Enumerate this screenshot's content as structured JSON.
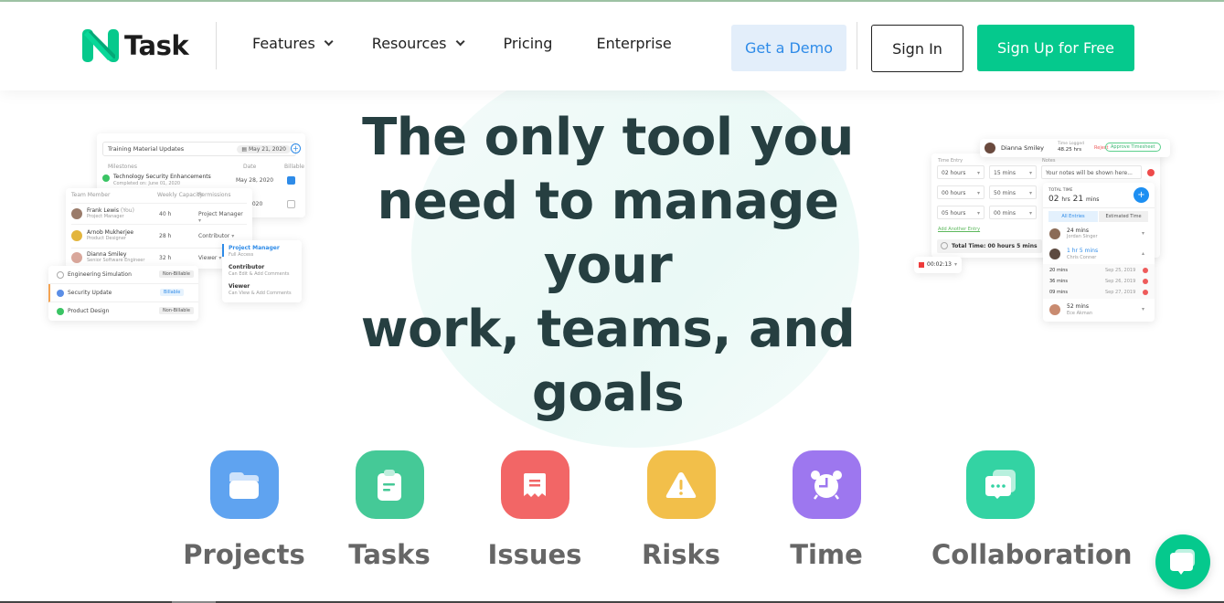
{
  "brand": {
    "name": "Task",
    "accent": "#05c98d"
  },
  "nav": {
    "items": [
      {
        "label": "Features",
        "has_dropdown": true
      },
      {
        "label": "Resources",
        "has_dropdown": true
      },
      {
        "label": "Pricing",
        "has_dropdown": false
      },
      {
        "label": "Enterprise",
        "has_dropdown": false
      }
    ],
    "demo_label": "Get a Demo",
    "signin_label": "Sign In",
    "signup_label": "Sign Up for Free"
  },
  "hero": {
    "headline_lines": [
      "The only tool you",
      "need to manage your",
      "work, teams, and",
      "goals"
    ]
  },
  "left_mock": {
    "milestone_input": "Training Material Updates",
    "milestone_date": "May 21, 2020",
    "milestone_headers": {
      "name": "Milestones",
      "date": "Date",
      "billable": "Billable"
    },
    "milestones": [
      {
        "name": "Technology Security Enhancements",
        "sub": "Completed on: June 01, 2020",
        "date": "May 28, 2020",
        "billable": true
      },
      {
        "name": "",
        "sub": "",
        "date": "2020",
        "billable": false
      }
    ],
    "team_headers": {
      "member": "Team Member",
      "capacity": "Weekly Capacity",
      "permissions": "Permissions"
    },
    "team": [
      {
        "name": "Frank Lewis",
        "you": "(You)",
        "role": "Project Manager",
        "capacity": "40 h",
        "permission": "Project Manager"
      },
      {
        "name": "Arnob Mukherjee",
        "you": "",
        "role": "Product Designer",
        "capacity": "28 h",
        "permission": "Contributor"
      },
      {
        "name": "Dianna Smiley",
        "you": "",
        "role": "Senior Software Engineer",
        "capacity": "32 h",
        "permission": "Viewer"
      }
    ],
    "permission_menu": [
      {
        "title": "Project Manager",
        "desc": "Full Access",
        "selected": true
      },
      {
        "title": "Contributor",
        "desc": "Can Edit & Add Comments",
        "selected": false
      },
      {
        "title": "Viewer",
        "desc": "Can View & Add Comments",
        "selected": false
      }
    ],
    "tasks": [
      {
        "name": "Engineering Simulation",
        "badge": "Non-Billable",
        "status": "open"
      },
      {
        "name": "Security Update",
        "badge": "Billable",
        "status": "in-progress"
      },
      {
        "name": "Product Design",
        "badge": "Non-Billable",
        "status": "done"
      }
    ]
  },
  "right_mock": {
    "approver": {
      "name": "Dianna Smiley",
      "time_label": "Time Logged",
      "time_value": "48.25 hrs",
      "reject": "Reject",
      "approve": "Approve Timesheet"
    },
    "time_entry_label": "Time Entry",
    "notes_label": "Notes",
    "notes_placeholder": "Your notes will be shown here...",
    "entries": [
      {
        "hours": "02 hours",
        "mins": "15 mins"
      },
      {
        "hours": "00 hours",
        "mins": "50 mins"
      },
      {
        "hours": "05 hours",
        "mins": "00 mins"
      }
    ],
    "add_entry": "Add Another Entry",
    "total_time_row": "Total Time: 00 hours 5 mins",
    "timer": "00:02:13",
    "summary": {
      "label": "TOTAL TIME",
      "hrs": "02",
      "hrs_unit": "hrs",
      "mins": "21",
      "mins_unit": "mins",
      "tabs": [
        "All Entries",
        "Estimated Time"
      ],
      "people": [
        {
          "time": "24 mins",
          "name": "Jordan Singer"
        },
        {
          "time": "1 hr 5 mins",
          "name": "Chris Conner"
        }
      ],
      "details": [
        {
          "time": "20 mins",
          "date": "Sep 25, 2019"
        },
        {
          "time": "36 mins",
          "date": "Sep 26, 2019"
        },
        {
          "time": "09 mins",
          "date": "Sep 27, 2019"
        }
      ],
      "last_person": {
        "time": "52 mins",
        "name": "Ece Akman"
      }
    }
  },
  "features": [
    {
      "label": "Projects",
      "icon": "folder-icon",
      "color": "#5fa3f0"
    },
    {
      "label": "Tasks",
      "icon": "clipboard-icon",
      "color": "#45c997"
    },
    {
      "label": "Issues",
      "icon": "ticket-icon",
      "color": "#f26666"
    },
    {
      "label": "Risks",
      "icon": "warning-icon",
      "color": "#f2bf4a"
    },
    {
      "label": "Time",
      "icon": "alarm-clock-icon",
      "color": "#9d77ef"
    },
    {
      "label": "Collaboration",
      "icon": "chat-bubbles-icon",
      "color": "#33d3a3"
    }
  ]
}
